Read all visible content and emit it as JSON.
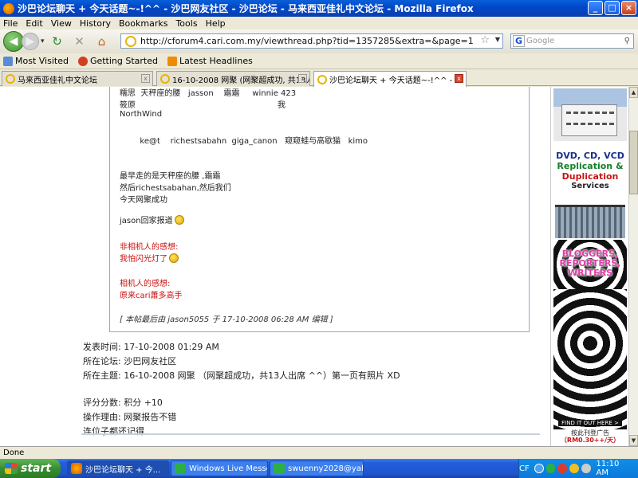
{
  "window": {
    "title": "沙巴论坛聊天 + 今天话题~-!^^ - 沙巴网友社区 - 沙巴论坛 - 马来西亚佳礼中文论坛 - Mozilla Firefox"
  },
  "menu": [
    "File",
    "Edit",
    "View",
    "History",
    "Bookmarks",
    "Tools",
    "Help"
  ],
  "nav": {
    "url": "http://cforum4.cari.com.my/viewthread.php?tid=1357285&extra=&page=1",
    "search_placeholder": "Google",
    "search_engine": "G"
  },
  "bookmarks": [
    "Most Visited",
    "Getting Started",
    "Latest Headlines"
  ],
  "tabs": [
    {
      "label": "马来西亚佳礼中文论坛"
    },
    {
      "label": "16-10-2008 网聚 (网聚超成功, 共13人..."
    },
    {
      "label": "沙巴论坛聊天 + 今天话题~-!^^ - ..."
    }
  ],
  "post": {
    "lines": [
      {
        "text": "糯思  天秤座的腰   jasson    霜霜     winnie 423",
        "red": false
      },
      {
        "text": "筱原                                                        我",
        "red": false
      },
      {
        "text": "NorthWind",
        "red": false
      },
      {
        "text": "        ke@t    richestsabahn  giga_canon   窥窥蛙与高歇猫   kimo",
        "red": false
      },
      {
        "text": "最早走的是天秤座的腰 ,霜霜",
        "red": false
      },
      {
        "text": "然后richestsabahan,然后我们",
        "red": false
      },
      {
        "text": "今天网聚成功",
        "red": false
      },
      {
        "text": "jason回家报道",
        "red": false
      },
      {
        "text": "非相机人的感想:",
        "red": true
      },
      {
        "text": "我怕闪光灯了",
        "red": true
      },
      {
        "text": "相机人的感想:",
        "red": true
      },
      {
        "text": "原来cari蕭多高手",
        "red": true
      },
      {
        "text": "[ 本帖最后由 jason5055 于 17-10-2008 06:28 AM 编辑 ]",
        "red": false
      }
    ],
    "meta": [
      "发表时间: 17-10-2008 01:29 AM",
      "所在论坛: 沙巴网友社区",
      "所在主题: 16-10-2008 网聚 （网聚超成功，共13人出席 ^^）第一页有照片 XD",
      "评分分数: 积分 +10",
      "操作理由: 网聚报告不错",
      "连位子都还记得"
    ]
  },
  "sidebar": {
    "ad_dvd": [
      "DVD, CD, VCD",
      "Replication &",
      "Duplication",
      "Services"
    ],
    "ad_bloggers": "BLOGGERS, REPORTERS, WRITERS",
    "find_it_out": "FIND IT OUT HERE >",
    "ad_footer_1": "按此刊登广告",
    "ad_footer_2": "（RM0.30++/天）"
  },
  "status": "Done",
  "taskbar": {
    "start": "start",
    "items": [
      "沙巴论坛聊天 + 今...",
      "Windows Live Messen...",
      "swuenny2028@yaho..."
    ],
    "lang": "CF",
    "clock": "11:10 AM"
  }
}
